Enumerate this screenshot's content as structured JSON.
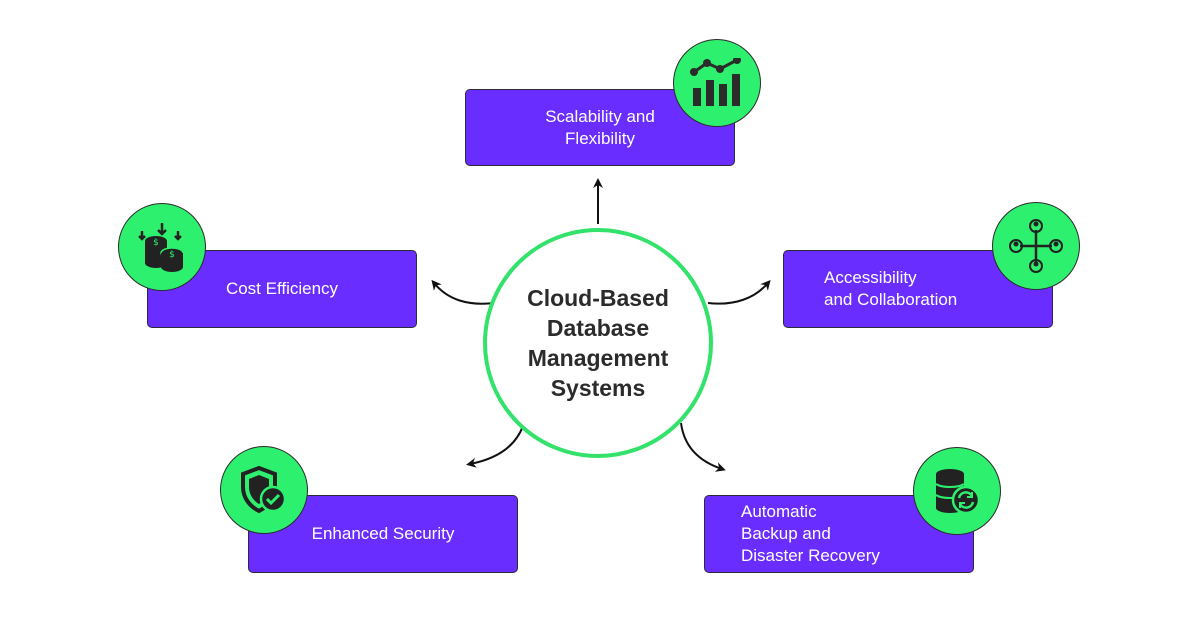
{
  "center": {
    "title": "Cloud-Based\nDatabase\nManagement\nSystems"
  },
  "colors": {
    "box": "#6a2dff",
    "badge": "#2ef06f",
    "ring": "#33e26b",
    "text_dark": "#2b2b2b"
  },
  "nodes": [
    {
      "id": "scalability",
      "label": "Scalability and\nFlexibility",
      "icon": "bar-chart-trend-icon"
    },
    {
      "id": "cost",
      "label": "Cost Efficiency",
      "icon": "coins-dollar-icon"
    },
    {
      "id": "accessibility",
      "label": "Accessibility\nand Collaboration",
      "icon": "people-network-icon"
    },
    {
      "id": "security",
      "label": "Enhanced Security",
      "icon": "shield-check-icon"
    },
    {
      "id": "backup",
      "label": "Automatic\nBackup and\nDisaster Recovery",
      "icon": "database-sync-icon"
    }
  ]
}
